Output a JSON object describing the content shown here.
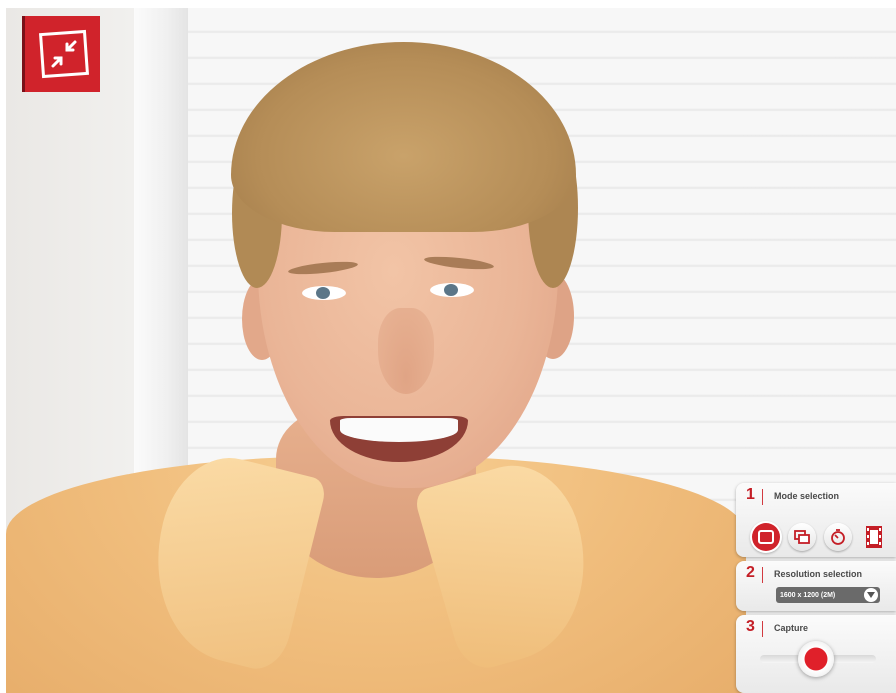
{
  "exit_fullscreen": {
    "icon": "exit-fullscreen-icon",
    "color": "#d0232b"
  },
  "panel": {
    "accent": "#c41e26",
    "steps": [
      {
        "number": "1",
        "title": "Mode selection"
      },
      {
        "number": "2",
        "title": "Resolution selection"
      },
      {
        "number": "3",
        "title": "Capture"
      }
    ],
    "modes": [
      {
        "icon": "single-photo-icon",
        "selected": true
      },
      {
        "icon": "burst-photo-icon",
        "selected": false
      },
      {
        "icon": "self-timer-icon",
        "selected": false
      },
      {
        "icon": "video-film-icon",
        "selected": false
      }
    ],
    "resolution": {
      "value": "1600 x 1200 (2M)"
    }
  }
}
